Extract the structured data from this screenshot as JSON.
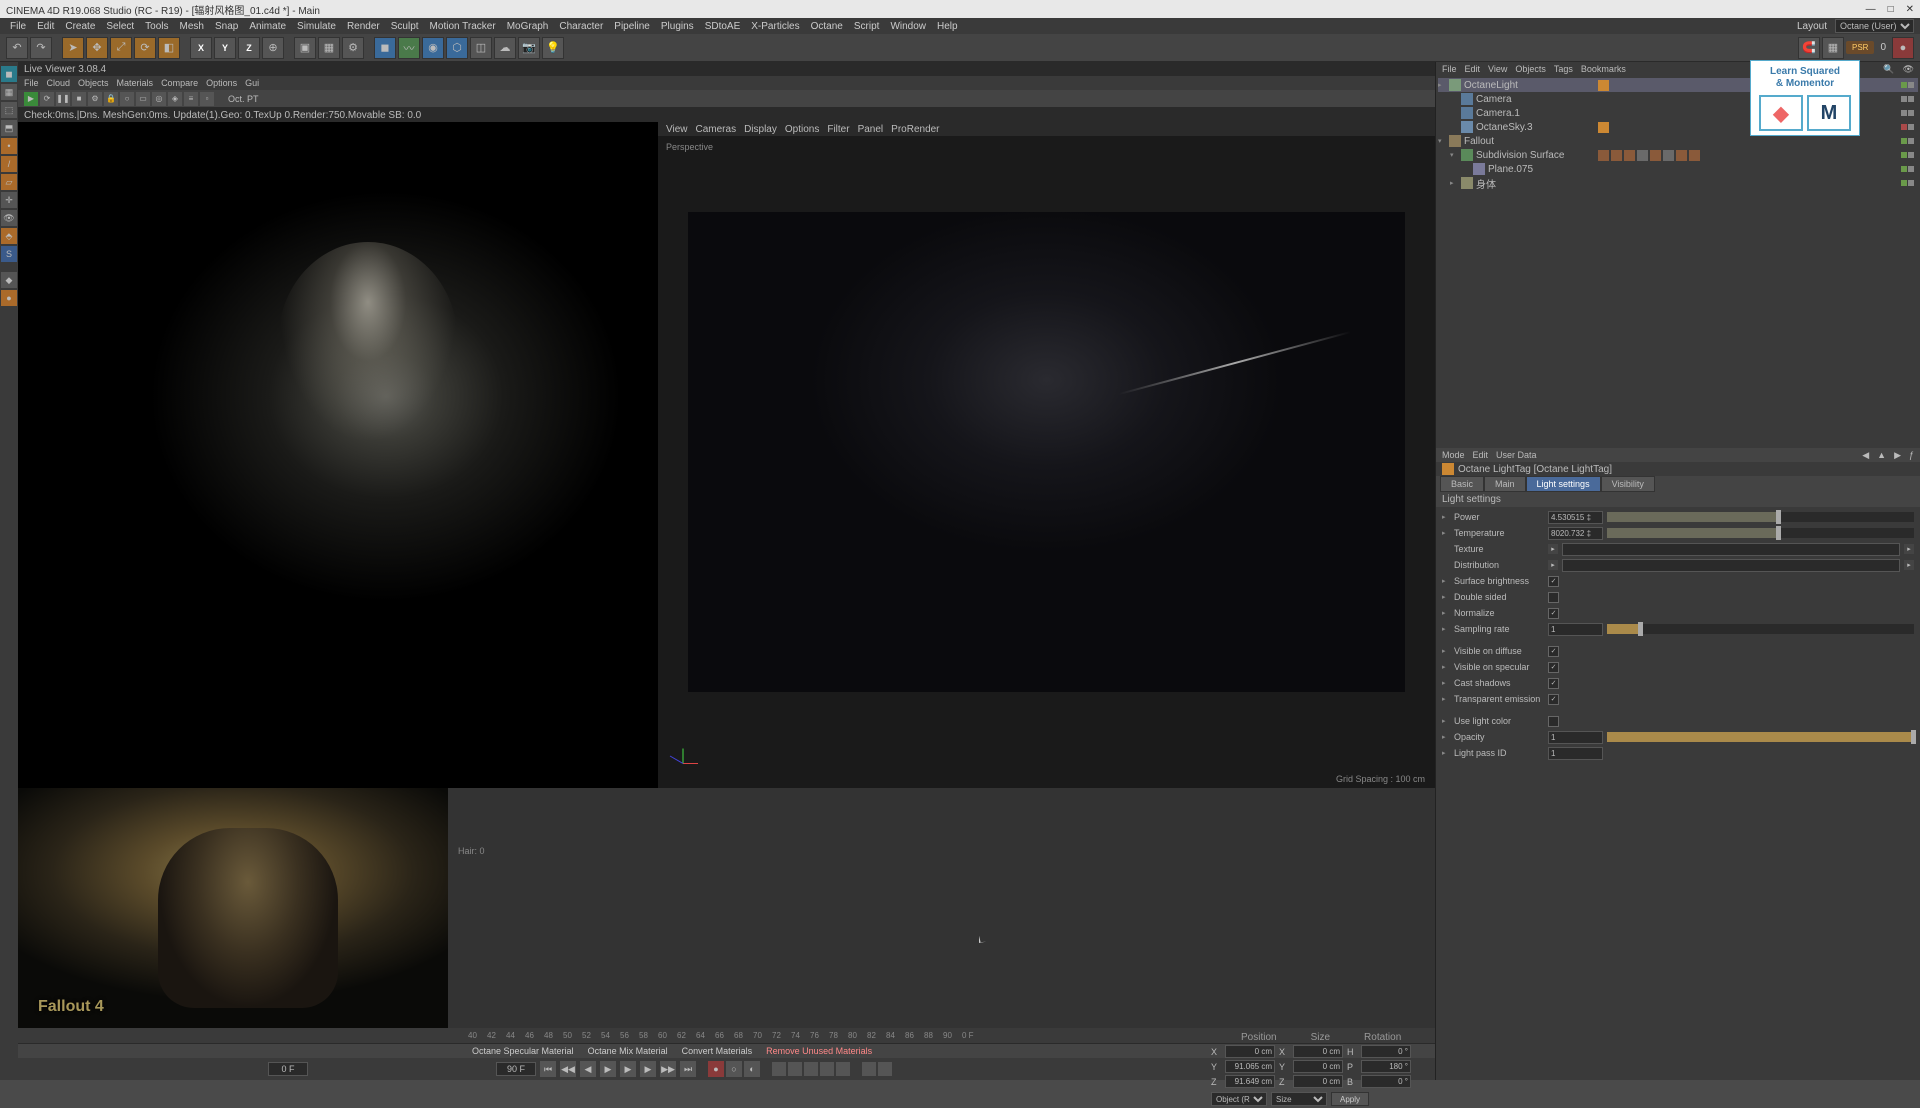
{
  "titlebar": {
    "text": "CINEMA 4D R19.068 Studio (RC - R19) - [辐射风格图_01.c4d *] - Main",
    "min": "—",
    "max": "□",
    "close": "✕"
  },
  "menubar": {
    "items": [
      "File",
      "Edit",
      "Create",
      "Select",
      "Tools",
      "Mesh",
      "Snap",
      "Animate",
      "Simulate",
      "Render",
      "Sculpt",
      "Motion Tracker",
      "MoGraph",
      "Character",
      "Pipeline",
      "Plugins",
      "SDtoAE",
      "X-Particles",
      "Octane",
      "Script",
      "Window",
      "Help"
    ],
    "layout_label": "Layout",
    "layout_value": "Octane (User)"
  },
  "toolbar": {
    "psr": "PSR",
    "zero": "0"
  },
  "liveviewer": {
    "header": "Live Viewer 3.08.4",
    "menus": [
      "File",
      "Cloud",
      "Objects",
      "Materials",
      "Compare",
      "Options",
      "Gui"
    ],
    "pt_label": "Oct.  PT",
    "status": "Check:0ms.|Dns. MeshGen:0ms. Update(1).Geo: 0.TexUp 0.Render:750.Movable SB: 0.0"
  },
  "perspective": {
    "menus": [
      "View",
      "Cameras",
      "Display",
      "Options",
      "Filter",
      "Panel",
      "ProRender"
    ],
    "title": "Perspective",
    "grid": "Grid Spacing : 100 cm",
    "hair": "Hair: 0"
  },
  "reference": {
    "logo": "Fallout 4"
  },
  "timeline": {
    "frames": [
      "40",
      "42",
      "44",
      "46",
      "48",
      "50",
      "52",
      "54",
      "56",
      "58",
      "60",
      "62",
      "64",
      "66",
      "68",
      "70",
      "72",
      "74",
      "76",
      "78",
      "80",
      "82",
      "84",
      "86",
      "88",
      "90",
      "0 F"
    ],
    "materials": {
      "m1": "Octane Specular Material",
      "m2": "Octane Mix Material",
      "m3": "Convert Materials",
      "m4": "Remove Unused Materials"
    },
    "frame_start": "0 F",
    "frame_end": "90 F"
  },
  "coords": {
    "hdr": {
      "p": "Position",
      "s": "Size",
      "r": "Rotation"
    },
    "x": {
      "p": "0 cm",
      "s": "0 cm",
      "r": "0 °"
    },
    "y": {
      "p": "91.065 cm",
      "s": "0 cm",
      "r": "180 °"
    },
    "z": {
      "p": "91.649 cm",
      "s": "0 cm",
      "r": "0 °"
    },
    "obj": "Object (Rel)",
    "size": "Size",
    "apply": "Apply"
  },
  "objects": {
    "menus": [
      "File",
      "Edit",
      "View",
      "Objects",
      "Tags",
      "Bookmarks"
    ],
    "items": [
      {
        "name": "OctaneLight",
        "depth": 0,
        "sel": true
      },
      {
        "name": "Camera",
        "depth": 1
      },
      {
        "name": "Camera.1",
        "depth": 1
      },
      {
        "name": "OctaneSky.3",
        "depth": 1
      },
      {
        "name": "Fallout",
        "depth": 0
      },
      {
        "name": "Subdivision Surface",
        "depth": 1
      },
      {
        "name": "Plane.075",
        "depth": 2
      },
      {
        "name": "身体",
        "depth": 1
      }
    ]
  },
  "attributes": {
    "nav": [
      "Mode",
      "Edit",
      "User Data"
    ],
    "title": "Octane LightTag [Octane LightTag]",
    "tabs": [
      "Basic",
      "Main",
      "Light settings",
      "Visibility"
    ],
    "active_tab": "Light settings",
    "section": "Light settings",
    "rows": {
      "power": {
        "lbl": "Power",
        "val": "4.530515 ‡"
      },
      "temperature": {
        "lbl": "Temperature",
        "val": "8020.732 ‡"
      },
      "texture": {
        "lbl": "Texture"
      },
      "distribution": {
        "lbl": "Distribution"
      },
      "surface_brightness": {
        "lbl": "Surface brightness"
      },
      "double_sided": {
        "lbl": "Double sided"
      },
      "normalize": {
        "lbl": "Normalize"
      },
      "sampling_rate": {
        "lbl": "Sampling rate",
        "val": "1"
      },
      "visible_diffuse": {
        "lbl": "Visible on diffuse"
      },
      "visible_specular": {
        "lbl": "Visible on specular"
      },
      "cast_shadows": {
        "lbl": "Cast shadows"
      },
      "transparent_emission": {
        "lbl": "Transparent emission"
      },
      "use_light_color": {
        "lbl": "Use light color"
      },
      "opacity": {
        "lbl": "Opacity",
        "val": "1"
      },
      "light_pass_id": {
        "lbl": "Light pass ID",
        "val": "1"
      }
    }
  },
  "badge": {
    "line1": "Learn Squared",
    "line2": "& Momentor",
    "m": "M"
  }
}
